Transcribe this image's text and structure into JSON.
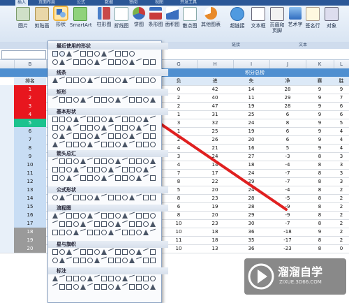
{
  "ribbon": {
    "tabs": [
      "插入",
      "页面布局",
      "公式",
      "数据",
      "审阅",
      "视图",
      "开发工具"
    ],
    "buttons": [
      {
        "label": "图片"
      },
      {
        "label": "剪贴画"
      },
      {
        "label": "形状"
      },
      {
        "label": "SmartArt"
      },
      {
        "label": "柱形图"
      },
      {
        "label": "折线图"
      },
      {
        "label": "饼图"
      },
      {
        "label": "条形图"
      },
      {
        "label": "面积图"
      },
      {
        "label": "散点图"
      },
      {
        "label": "其他图表"
      },
      {
        "label": "超链接"
      },
      {
        "label": "文本框"
      },
      {
        "label": "页眉和页脚"
      },
      {
        "label": "艺术字"
      },
      {
        "label": "签名行"
      },
      {
        "label": "对象"
      }
    ],
    "group_links": "链接",
    "group_text": "文本"
  },
  "formula_bar": {
    "fx": "fx"
  },
  "sheet": {
    "columns": [
      "B",
      "G",
      "H",
      "I",
      "J",
      "K",
      "L"
    ],
    "header_merged": "积分总榜",
    "header_row": [
      "排名",
      "负",
      "进",
      "失",
      "净",
      "赛",
      "胜"
    ],
    "rows": [
      [
        "1",
        "0",
        "42",
        "14",
        "28",
        "9",
        "9"
      ],
      [
        "2",
        "2",
        "40",
        "11",
        "29",
        "9",
        "7"
      ],
      [
        "3",
        "2",
        "47",
        "19",
        "28",
        "9",
        "6"
      ],
      [
        "4",
        "1",
        "31",
        "25",
        "6",
        "9",
        "6"
      ],
      [
        "5",
        "3",
        "32",
        "24",
        "8",
        "9",
        "5"
      ],
      [
        "6",
        "1",
        "25",
        "19",
        "6",
        "9",
        "4"
      ],
      [
        "7",
        "2",
        "26",
        "20",
        "6",
        "9",
        "4"
      ],
      [
        "8",
        "4",
        "21",
        "16",
        "5",
        "9",
        "4"
      ],
      [
        "9",
        "3",
        "24",
        "27",
        "-3",
        "8",
        "3"
      ],
      [
        "10",
        "4",
        "14",
        "18",
        "-4",
        "8",
        "3"
      ],
      [
        "11",
        "7",
        "17",
        "24",
        "-7",
        "8",
        "3"
      ],
      [
        "12",
        "8",
        "22",
        "29",
        "-7",
        "8",
        "3"
      ],
      [
        "13",
        "5",
        "20",
        "24",
        "-4",
        "8",
        "2"
      ],
      [
        "14",
        "8",
        "23",
        "28",
        "-5",
        "8",
        "2"
      ],
      [
        "15",
        "6",
        "19",
        "28",
        "-9",
        "8",
        "2"
      ],
      [
        "16",
        "8",
        "20",
        "29",
        "-9",
        "8",
        "2"
      ],
      [
        "17",
        "10",
        "23",
        "30",
        "-7",
        "8",
        "2"
      ],
      [
        "18",
        "10",
        "18",
        "36",
        "-18",
        "9",
        "2"
      ],
      [
        "19",
        "11",
        "18",
        "35",
        "-17",
        "8",
        "2"
      ],
      [
        "20",
        "10",
        "13",
        "36",
        "-23",
        "8",
        "0"
      ]
    ]
  },
  "shape_menu": {
    "sections": [
      "最近使用的形状",
      "线条",
      "矩形",
      "基本形状",
      "箭头总汇",
      "公式形状",
      "流程图",
      "星与旗帜",
      "标注"
    ]
  },
  "watermark": {
    "title": "溜溜自学",
    "url": "ZIXUE.3D66.COM"
  }
}
